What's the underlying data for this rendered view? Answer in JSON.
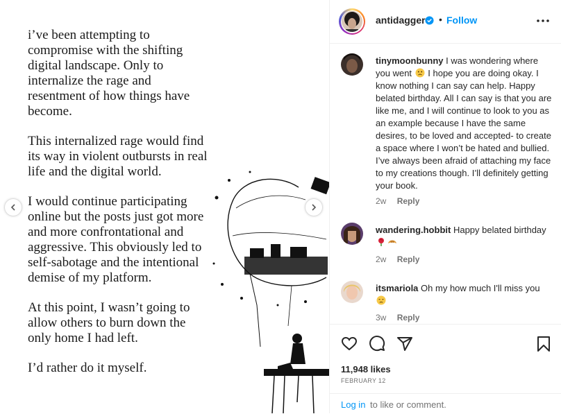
{
  "post": {
    "paragraphs": [
      "i’ve been attempting to\ncompromise with the shifting\ndigital landscape.  Only to\ninternalize the rage and\nresentment of how things have\nbecome.",
      "This internalized rage would find\nits way in violent outbursts in real\nlife and the digital world.",
      "I would continue participating\nonline but the posts just got more\nand more confrontational and\naggressive. This obviously led to\nself-sabotage and the intentional\ndemise of my platform.",
      "At this point, I wasn’t going to\nallow others to burn down the\nonly home I had left.",
      "I’d rather do it myself."
    ]
  },
  "header": {
    "username": "antidagger",
    "separator": "•",
    "follow_label": "Follow"
  },
  "comments": [
    {
      "username": "tinymoonbunny",
      "text_before_emoji": "I was wondering where you went ",
      "text_after_emoji": " I hope you are doing okay. I know nothing I can say can help. Happy belated birthday. All I can say is that you are like me, and I will continue to look to you as an example because I have the same desires, to be loved and accepted- to create a space where I won’t be hated and bullied. I’ve always been afraid of attaching my face to my creations though. I’ll definitely getting your book.",
      "time": "2w",
      "reply_label": "Reply",
      "emoji": "sad-face"
    },
    {
      "username": "wandering.hobbit",
      "text_before_emoji": "Happy belated birthday ",
      "text_after_emoji": "",
      "time": "2w",
      "reply_label": "Reply",
      "emoji": "rose, croissant"
    },
    {
      "username": "itsmariola",
      "text_before_emoji": "Oh my how much I'll miss you ",
      "text_after_emoji": "",
      "time": "3w",
      "reply_label": "Reply",
      "emoji": "disappointed-face"
    }
  ],
  "actions": {
    "likes": "11,948 likes",
    "date": "FEBRUARY 12"
  },
  "footer": {
    "login_label": "Log in",
    "rest_text": "to like or comment."
  },
  "colors": {
    "accent": "#0095f6",
    "muted": "#737373",
    "text": "#262626"
  }
}
